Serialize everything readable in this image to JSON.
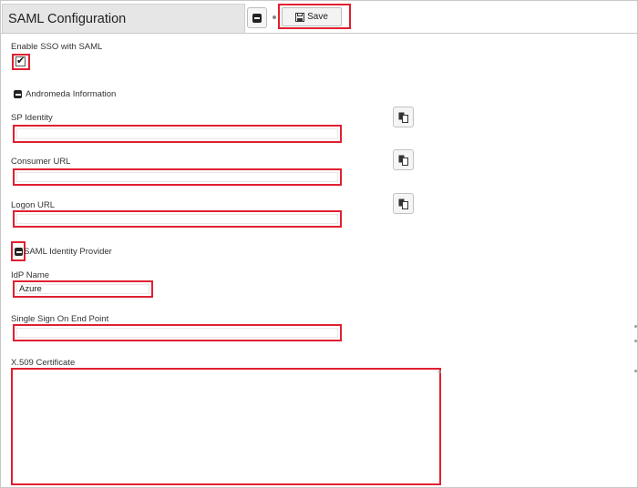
{
  "header": {
    "title": "SAML Configuration",
    "save_label": "Save"
  },
  "sso": {
    "enable_label": "Enable SSO with SAML",
    "checked": true,
    "check_glyph": "✔"
  },
  "andromeda": {
    "section_label": "Andromeda Information",
    "sp_identity_label": "SP Identity",
    "sp_identity_value": "",
    "consumer_url_label": "Consumer URL",
    "consumer_url_value": "",
    "logon_url_label": "Logon URL",
    "logon_url_value": ""
  },
  "idp": {
    "section_label": "SAML Identity Provider",
    "idp_name_label": "IdP Name",
    "idp_name_value": "Azure",
    "sso_endpoint_label": "Single Sign On End Point",
    "sso_endpoint_value": "",
    "certificate_label": "X.509 Certificate",
    "certificate_value": ""
  },
  "colors": {
    "highlight": "#e02030",
    "title_bar": "#e6e6e6"
  },
  "icons": [
    "minus-square-icon",
    "floppy-disk-icon",
    "checkbox-check-icon",
    "copy-clipboard-icon"
  ]
}
